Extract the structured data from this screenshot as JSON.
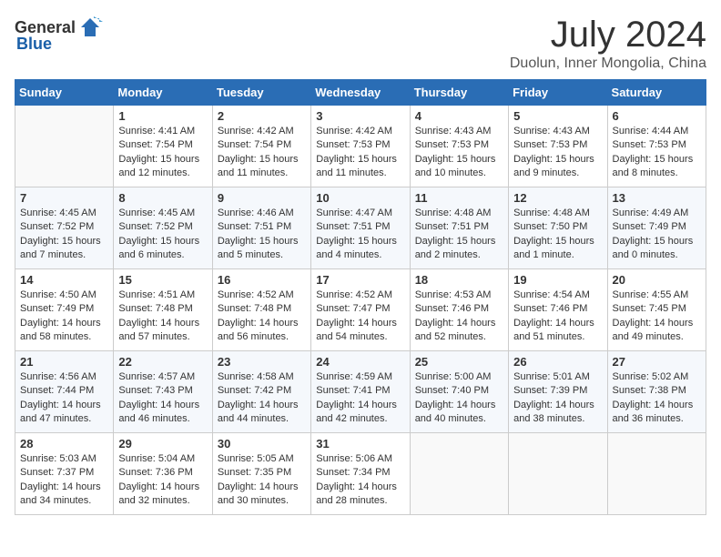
{
  "logo": {
    "text_general": "General",
    "text_blue": "Blue"
  },
  "title": "July 2024",
  "location": "Duolun, Inner Mongolia, China",
  "days_header": [
    "Sunday",
    "Monday",
    "Tuesday",
    "Wednesday",
    "Thursday",
    "Friday",
    "Saturday"
  ],
  "weeks": [
    [
      {
        "day": "",
        "sunrise": "",
        "sunset": "",
        "daylight": "",
        "empty": true
      },
      {
        "day": "1",
        "sunrise": "4:41 AM",
        "sunset": "7:54 PM",
        "daylight": "15 hours and 12 minutes."
      },
      {
        "day": "2",
        "sunrise": "4:42 AM",
        "sunset": "7:54 PM",
        "daylight": "15 hours and 11 minutes."
      },
      {
        "day": "3",
        "sunrise": "4:42 AM",
        "sunset": "7:53 PM",
        "daylight": "15 hours and 11 minutes."
      },
      {
        "day": "4",
        "sunrise": "4:43 AM",
        "sunset": "7:53 PM",
        "daylight": "15 hours and 10 minutes."
      },
      {
        "day": "5",
        "sunrise": "4:43 AM",
        "sunset": "7:53 PM",
        "daylight": "15 hours and 9 minutes."
      },
      {
        "day": "6",
        "sunrise": "4:44 AM",
        "sunset": "7:53 PM",
        "daylight": "15 hours and 8 minutes."
      }
    ],
    [
      {
        "day": "7",
        "sunrise": "4:45 AM",
        "sunset": "7:52 PM",
        "daylight": "15 hours and 7 minutes."
      },
      {
        "day": "8",
        "sunrise": "4:45 AM",
        "sunset": "7:52 PM",
        "daylight": "15 hours and 6 minutes."
      },
      {
        "day": "9",
        "sunrise": "4:46 AM",
        "sunset": "7:51 PM",
        "daylight": "15 hours and 5 minutes."
      },
      {
        "day": "10",
        "sunrise": "4:47 AM",
        "sunset": "7:51 PM",
        "daylight": "15 hours and 4 minutes."
      },
      {
        "day": "11",
        "sunrise": "4:48 AM",
        "sunset": "7:51 PM",
        "daylight": "15 hours and 2 minutes."
      },
      {
        "day": "12",
        "sunrise": "4:48 AM",
        "sunset": "7:50 PM",
        "daylight": "15 hours and 1 minute."
      },
      {
        "day": "13",
        "sunrise": "4:49 AM",
        "sunset": "7:49 PM",
        "daylight": "15 hours and 0 minutes."
      }
    ],
    [
      {
        "day": "14",
        "sunrise": "4:50 AM",
        "sunset": "7:49 PM",
        "daylight": "14 hours and 58 minutes."
      },
      {
        "day": "15",
        "sunrise": "4:51 AM",
        "sunset": "7:48 PM",
        "daylight": "14 hours and 57 minutes."
      },
      {
        "day": "16",
        "sunrise": "4:52 AM",
        "sunset": "7:48 PM",
        "daylight": "14 hours and 56 minutes."
      },
      {
        "day": "17",
        "sunrise": "4:52 AM",
        "sunset": "7:47 PM",
        "daylight": "14 hours and 54 minutes."
      },
      {
        "day": "18",
        "sunrise": "4:53 AM",
        "sunset": "7:46 PM",
        "daylight": "14 hours and 52 minutes."
      },
      {
        "day": "19",
        "sunrise": "4:54 AM",
        "sunset": "7:46 PM",
        "daylight": "14 hours and 51 minutes."
      },
      {
        "day": "20",
        "sunrise": "4:55 AM",
        "sunset": "7:45 PM",
        "daylight": "14 hours and 49 minutes."
      }
    ],
    [
      {
        "day": "21",
        "sunrise": "4:56 AM",
        "sunset": "7:44 PM",
        "daylight": "14 hours and 47 minutes."
      },
      {
        "day": "22",
        "sunrise": "4:57 AM",
        "sunset": "7:43 PM",
        "daylight": "14 hours and 46 minutes."
      },
      {
        "day": "23",
        "sunrise": "4:58 AM",
        "sunset": "7:42 PM",
        "daylight": "14 hours and 44 minutes."
      },
      {
        "day": "24",
        "sunrise": "4:59 AM",
        "sunset": "7:41 PM",
        "daylight": "14 hours and 42 minutes."
      },
      {
        "day": "25",
        "sunrise": "5:00 AM",
        "sunset": "7:40 PM",
        "daylight": "14 hours and 40 minutes."
      },
      {
        "day": "26",
        "sunrise": "5:01 AM",
        "sunset": "7:39 PM",
        "daylight": "14 hours and 38 minutes."
      },
      {
        "day": "27",
        "sunrise": "5:02 AM",
        "sunset": "7:38 PM",
        "daylight": "14 hours and 36 minutes."
      }
    ],
    [
      {
        "day": "28",
        "sunrise": "5:03 AM",
        "sunset": "7:37 PM",
        "daylight": "14 hours and 34 minutes."
      },
      {
        "day": "29",
        "sunrise": "5:04 AM",
        "sunset": "7:36 PM",
        "daylight": "14 hours and 32 minutes."
      },
      {
        "day": "30",
        "sunrise": "5:05 AM",
        "sunset": "7:35 PM",
        "daylight": "14 hours and 30 minutes."
      },
      {
        "day": "31",
        "sunrise": "5:06 AM",
        "sunset": "7:34 PM",
        "daylight": "14 hours and 28 minutes."
      },
      {
        "day": "",
        "sunrise": "",
        "sunset": "",
        "daylight": "",
        "empty": true
      },
      {
        "day": "",
        "sunrise": "",
        "sunset": "",
        "daylight": "",
        "empty": true
      },
      {
        "day": "",
        "sunrise": "",
        "sunset": "",
        "daylight": "",
        "empty": true
      }
    ]
  ]
}
